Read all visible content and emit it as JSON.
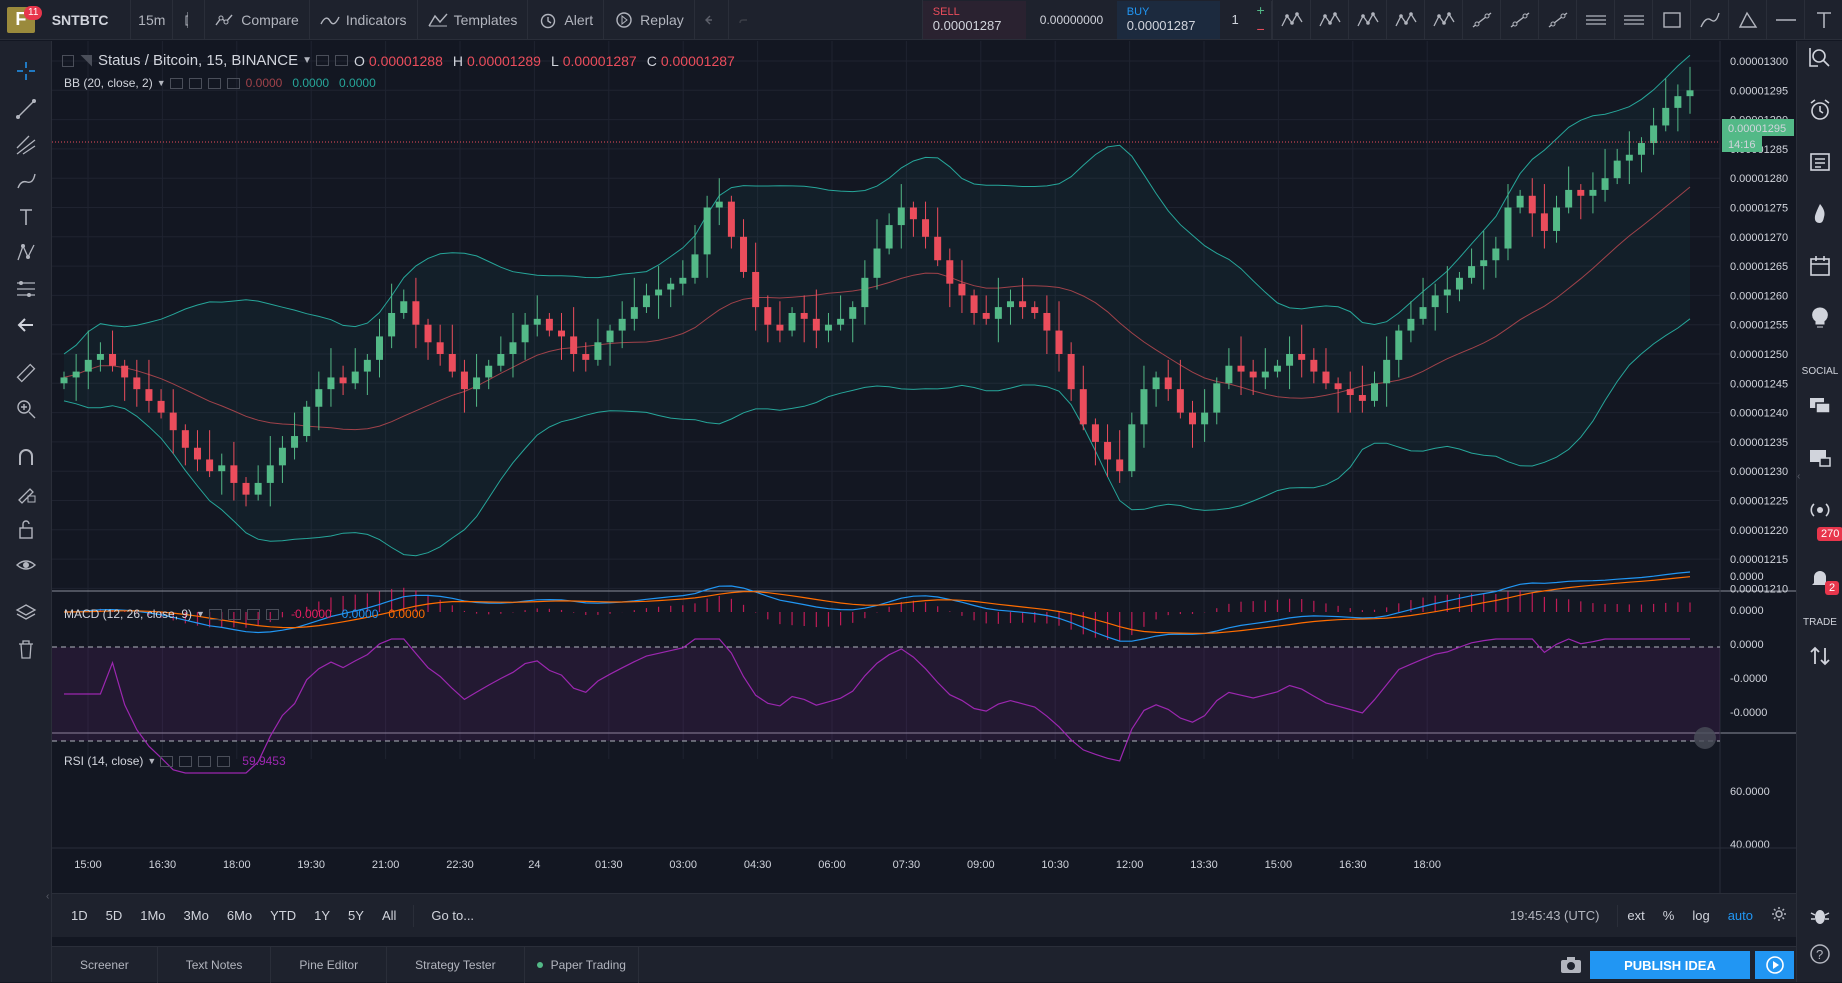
{
  "topbar": {
    "logo_badge": "11",
    "symbol": "SNTBTC",
    "interval": "15m",
    "compare": "Compare",
    "indicators": "Indicators",
    "templates": "Templates",
    "alert": "Alert",
    "replay": "Replay",
    "sell_label": "SELL",
    "sell_price": "0.00001287",
    "spread": "0.00000000",
    "buy_label": "BUY",
    "buy_price": "0.00001287",
    "quantity": "1"
  },
  "legend": {
    "title": "Status / Bitcoin, 15, BINANCE",
    "o_label": "O",
    "o_value": "0.00001288",
    "h_label": "H",
    "h_value": "0.00001289",
    "l_label": "L",
    "l_value": "0.00001287",
    "c_label": "C",
    "c_value": "0.00001287",
    "bb_label": "BB (20, close, 2)",
    "bb_v1": "0.0000",
    "bb_v2": "0.0000",
    "bb_v3": "0.0000",
    "macd_label": "MACD (12, 26, close, 9)",
    "macd_v1": "-0.0000",
    "macd_v2": "0.0000",
    "macd_v3": "0.0000",
    "rsi_label": "RSI (14, close)",
    "rsi_value": "59.9453"
  },
  "price_axis": {
    "labels": [
      "0.00001300",
      "0.00001295",
      "0.00001290",
      "0.00001285",
      "0.00001280",
      "0.00001275",
      "0.00001270",
      "0.00001265",
      "0.00001260",
      "0.00001255",
      "0.00001250",
      "0.00001245",
      "0.00001240",
      "0.00001235",
      "0.00001230",
      "0.00001225",
      "0.00001220",
      "0.00001215",
      "0.00001210"
    ],
    "current_price": "0.00001295",
    "countdown": "14:16"
  },
  "macd_axis": {
    "labels": [
      "0.0000",
      "0.0000",
      "0.0000",
      "-0.0000",
      "-0.0000"
    ]
  },
  "rsi_axis": {
    "labels": [
      "60.0000",
      "40.0000"
    ]
  },
  "time_axis": {
    "labels": [
      "15:00",
      "16:30",
      "18:00",
      "19:30",
      "21:00",
      "22:30",
      "24",
      "01:30",
      "03:00",
      "04:30",
      "06:00",
      "07:30",
      "09:00",
      "10:30",
      "12:00",
      "13:30",
      "15:00",
      "16:30",
      "18:00"
    ]
  },
  "bottombar": {
    "ranges": [
      "1D",
      "5D",
      "1Mo",
      "3Mo",
      "6Mo",
      "YTD",
      "1Y",
      "5Y",
      "All"
    ],
    "goto": "Go to...",
    "clock": "19:45:43 (UTC)",
    "ext": "ext",
    "percent": "%",
    "log": "log",
    "auto": "auto"
  },
  "footer": {
    "tabs": [
      "Screener",
      "Text Notes",
      "Pine Editor",
      "Strategy Tester",
      "Paper Trading"
    ],
    "publish": "PUBLISH IDEA"
  },
  "rightbar": {
    "social": "SOCIAL",
    "trade": "TRADE",
    "badge_270": "270",
    "badge_2": "2"
  },
  "colors": {
    "up": "#53b987",
    "down": "#eb4d5c",
    "bb": "#26a69a",
    "basis": "#a0424a",
    "macd": "#2196f3",
    "signal": "#ff6d00",
    "rsi": "#9c27b0"
  }
}
